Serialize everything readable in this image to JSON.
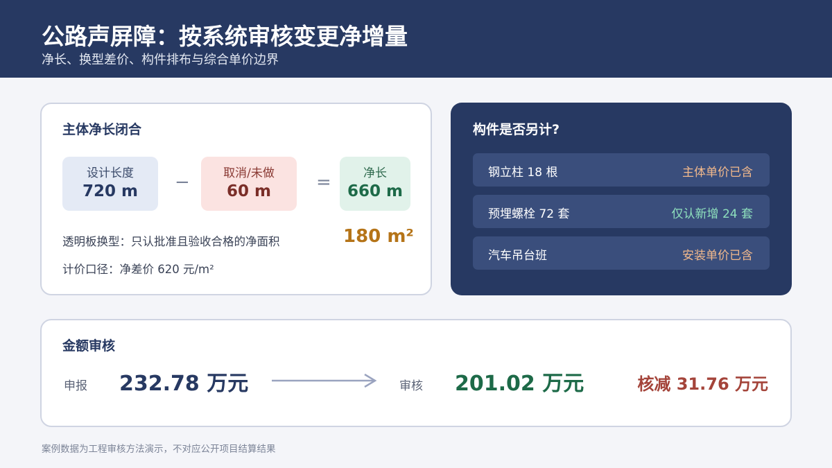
{
  "header": {
    "title": "公路声屏障：按系统审核变更净增量",
    "subtitle": "净长、换型差价、构件排布与综合单价边界"
  },
  "net_length": {
    "title": "主体净长闭合",
    "design": {
      "label": "设计长度",
      "value": "720 m"
    },
    "minus": "−",
    "cancel": {
      "label": "取消/未做",
      "value": "60 m"
    },
    "equals": "=",
    "net": {
      "label": "净长",
      "value": "660 m"
    },
    "note1": "透明板换型：只认批准且验收合格的净面积",
    "area": "180 m²",
    "note2": "计价口径：净差价 620 元/m²"
  },
  "components": {
    "title": "构件是否另计?",
    "items": [
      {
        "name": "钢立柱 18 根",
        "status": "主体单价已含",
        "color": "#f2b98c"
      },
      {
        "name": "预埋螺栓 72 套",
        "status": "仅认新增 24 套",
        "color": "#8ee0bd"
      },
      {
        "name": "汽车吊台班",
        "status": "安装单价已含",
        "color": "#f2b98c"
      }
    ]
  },
  "amount": {
    "title": "金额审核",
    "declared_label": "申报",
    "declared_value": "232.78 万元",
    "audited_label": "审核",
    "audited_value": "201.02 万元",
    "reduction": "核减 31.76 万元"
  },
  "footer": "案例数据为工程审核方法演示，不对应公开项目结算结果",
  "colors": {
    "header_bg": "#273962",
    "accent_orange": "#b57418",
    "accent_green": "#1d6a48",
    "accent_red": "#a4443a"
  }
}
